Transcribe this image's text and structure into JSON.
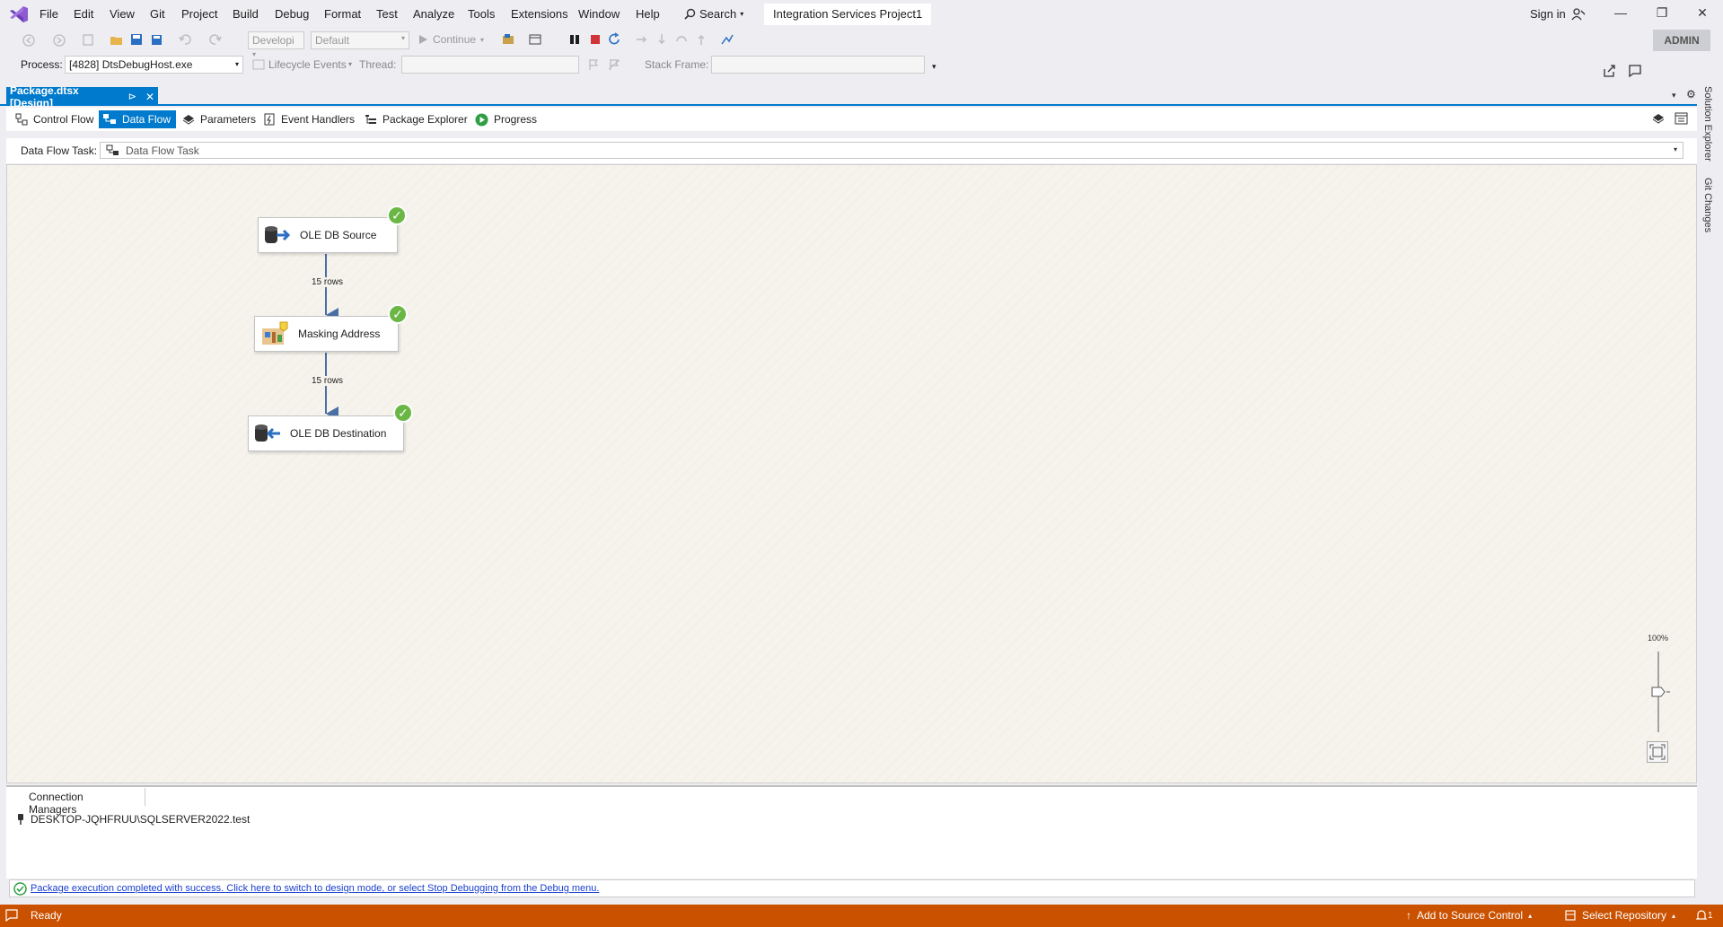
{
  "menubar": {
    "items": [
      "File",
      "Edit",
      "View",
      "Git",
      "Project",
      "Build",
      "Debug",
      "Format",
      "Test",
      "Analyze",
      "Tools",
      "Extensions",
      "Window",
      "Help"
    ],
    "search_label": "Search",
    "project_title": "Integration Services Project1",
    "sign_in": "Sign in"
  },
  "toolbar": {
    "config_combo": "Developi",
    "platform_combo": "Default",
    "continue_label": "Continue",
    "admin_badge": "ADMIN"
  },
  "debugbar": {
    "process_label": "Process:",
    "process_value": "[4828] DtsDebugHost.exe",
    "lifecycle_label": "Lifecycle Events",
    "thread_label": "Thread:",
    "stack_frame_label": "Stack Frame:"
  },
  "document_tab": {
    "title": "Package.dtsx [Design]"
  },
  "designer_tabs": [
    "Control Flow",
    "Data Flow",
    "Parameters",
    "Event Handlers",
    "Package Explorer",
    "Progress"
  ],
  "data_flow_task": {
    "label": "Data Flow Task:",
    "value": "Data Flow Task"
  },
  "canvas": {
    "nodes": [
      {
        "label": "OLE DB Source",
        "status": "success"
      },
      {
        "label": "Masking Address",
        "status": "success"
      },
      {
        "label": "OLE DB Destination",
        "status": "success"
      }
    ],
    "paths": [
      {
        "label": "15 rows"
      },
      {
        "label": "15 rows"
      }
    ],
    "zoom_label": "100%",
    "zoom_level": 1.0
  },
  "connection_managers": {
    "tab_label": "Connection Managers",
    "items": [
      "DESKTOP-JQHFRUU\\SQLSERVER2022.test"
    ]
  },
  "message": "Package execution completed with success. Click here to switch to design mode, or select Stop Debugging from the Debug menu.",
  "side_tabs": [
    "Solution Explorer",
    "Git Changes"
  ],
  "statusbar": {
    "ready": "Ready",
    "add_to_source_control": "Add to Source Control",
    "select_repository": "Select Repository",
    "notifications_count": "1"
  },
  "colors": {
    "accent": "#007acc",
    "statusbar": "#ca5100",
    "success": "#6bb746",
    "canvas": "#f5f3ec"
  }
}
